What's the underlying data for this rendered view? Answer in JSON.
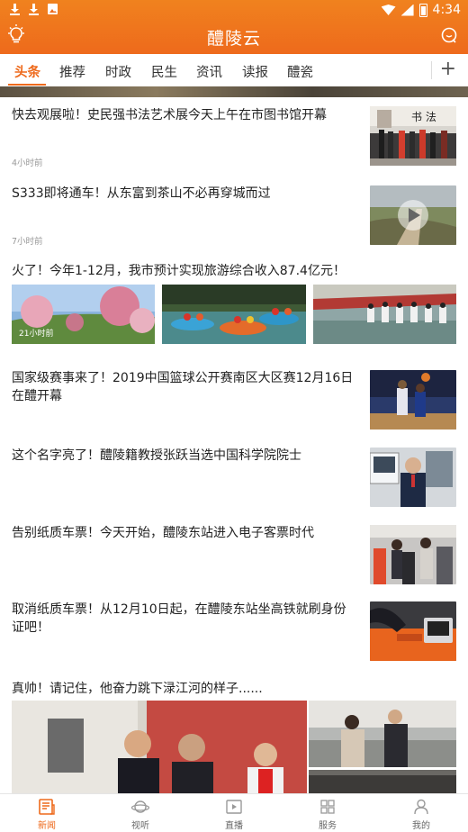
{
  "status_bar": {
    "left_icons": [
      "download-icon",
      "download-icon",
      "image-icon"
    ],
    "time": "4:34"
  },
  "header": {
    "title": "醴陵云",
    "left_icon": "lightbulb-icon",
    "right_icon": "chat-icon",
    "accent_color": "#ee6a1c"
  },
  "tabs": [
    {
      "label": "头条",
      "active": true
    },
    {
      "label": "推荐"
    },
    {
      "label": "时政"
    },
    {
      "label": "民生"
    },
    {
      "label": "资讯"
    },
    {
      "label": "读报"
    },
    {
      "label": "醴瓷"
    }
  ],
  "add_tab_label": "+",
  "feed": {
    "items": [
      {
        "title": "快去观展啦！史民强书法艺术展今天上午在市图书馆开幕",
        "time": "4小时前"
      },
      {
        "title": "S333即将通车！从东富到茶山不必再穿城而过",
        "time": "7小时前",
        "has_video": true
      },
      {
        "title": "火了！今年1-12月，我市预计实现旅游综合收入87.4亿元！",
        "image_tag": "21小时前"
      },
      {
        "title": "国家级赛事来了！2019中国篮球公开赛南区大区赛12月16日在醴开幕"
      },
      {
        "title": "这个名字亮了！醴陵籍教授张跃当选中国科学院院士"
      },
      {
        "title": "告别纸质车票！今天开始，醴陵东站进入电子客票时代"
      },
      {
        "title": "取消纸质车票！从12月10日起，在醴陵东站坐高铁就刷身份证吧！"
      },
      {
        "title": "真帅！请记住，他奋力跳下渌江河的样子......"
      }
    ]
  },
  "bottom_nav": [
    {
      "label": "新闻",
      "icon": "news-icon",
      "active": true
    },
    {
      "label": "视听",
      "icon": "planet-icon"
    },
    {
      "label": "直播",
      "icon": "live-icon"
    },
    {
      "label": "服务",
      "icon": "grid-icon"
    },
    {
      "label": "我的",
      "icon": "person-icon"
    }
  ]
}
